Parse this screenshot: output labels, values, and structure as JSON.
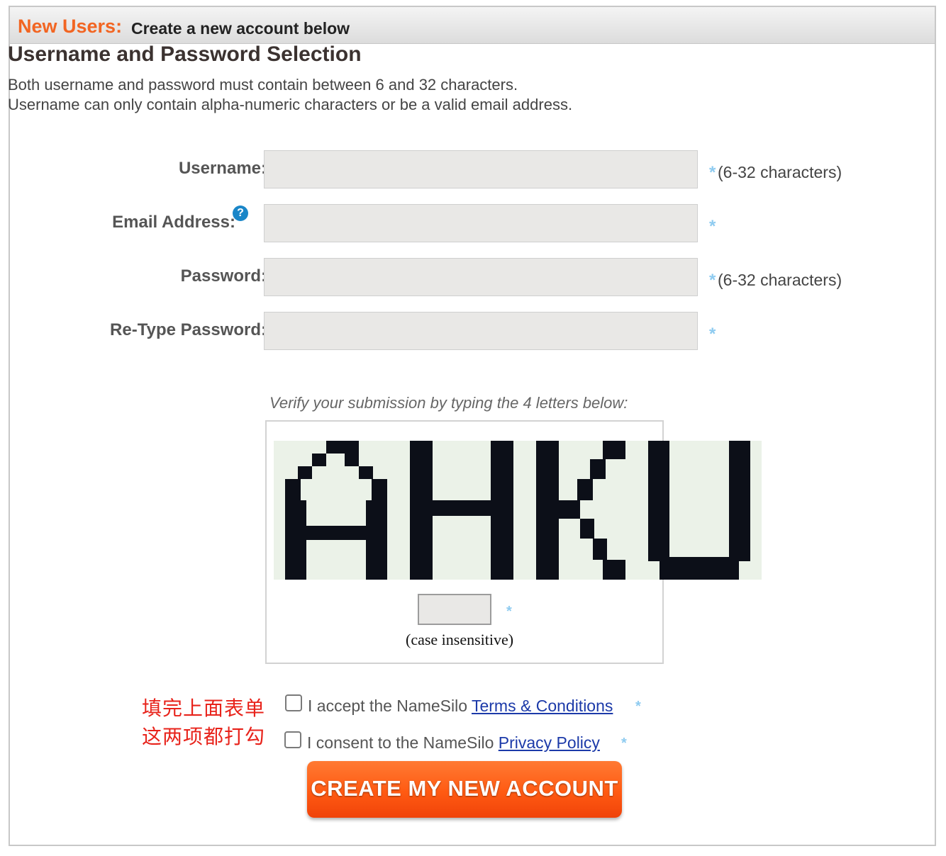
{
  "header": {
    "title": "New Users:",
    "subtitle": "Create a new account below"
  },
  "section": {
    "title": "Username and Password Selection",
    "desc1": "Both username and password must contain between 6 and 32 characters.",
    "desc2": "Username can only contain alpha-numeric characters or be a valid email address."
  },
  "fields": {
    "username_label": "Username:",
    "username_hint": "(6-32 characters)",
    "email_label": "Email Address:",
    "password_label": "Password:",
    "password_hint": "(6-32 characters)",
    "retype_label": "Re-Type Password:",
    "required_mark": "*",
    "help_icon_glyph": "?"
  },
  "captcha": {
    "instruction": "Verify your submission by typing the 4 letters below:",
    "letters": "AHKU",
    "note": "(case insensitive)"
  },
  "annotation": {
    "line1": "填完上面表单",
    "line2": "这两项都打勾"
  },
  "agreements": {
    "terms_prefix": "I accept the NameSilo ",
    "terms_link": "Terms & Conditions",
    "privacy_prefix": "I consent to the NameSilo ",
    "privacy_link": "Privacy Policy"
  },
  "submit_label": "CREATE MY NEW ACCOUNT",
  "colors": {
    "brand_orange": "#f26522",
    "annotation_red": "#e8231b",
    "link_blue": "#1c3aa9",
    "required_blue": "#8ecbf0"
  }
}
